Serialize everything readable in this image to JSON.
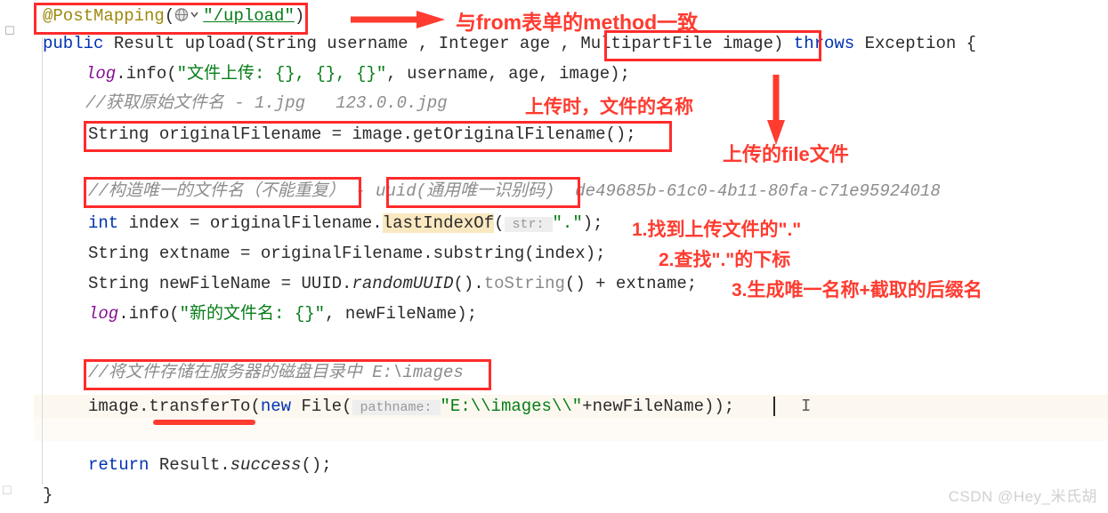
{
  "editor": {
    "gutter_icon": "globe-annotation-gutter-icon",
    "current_line_highlight_color": "#fdf8ef",
    "caret_glyph": "|",
    "mouse_cursor_glyph": "I"
  },
  "code_lines": [
    {
      "id": "line-postmapping",
      "segments": [
        {
          "text": "@PostMapping",
          "style": "anno"
        },
        {
          "text": "(",
          "style": "plain"
        },
        {
          "text": "globe-icon",
          "style": "icon"
        },
        {
          "text": "\"/upload\"",
          "style": "str-underline"
        },
        {
          "text": ")",
          "style": "plain"
        }
      ],
      "plain": "@PostMapping(\"/upload\")"
    },
    {
      "id": "line-method-signature",
      "segments": [
        {
          "text": "public ",
          "style": "keyword"
        },
        {
          "text": "Result ",
          "style": "plain"
        },
        {
          "text": "upload",
          "style": "plain"
        },
        {
          "text": "(String username , Integer age , MultipartFile image) ",
          "style": "plain"
        },
        {
          "text": "throws ",
          "style": "keyword"
        },
        {
          "text": "Exception {",
          "style": "plain"
        }
      ],
      "plain": "public Result upload(String username , Integer age , MultipartFile image) throws Exception {"
    },
    {
      "id": "line-log-info-1",
      "plain": "log.info(\"文件上传: {}, {}, {}\", username, age, image);"
    },
    {
      "id": "line-comment-originalname",
      "plain": "//获取原始文件名 - 1.jpg   123.0.0.jpg"
    },
    {
      "id": "line-original-filename",
      "plain": "String originalFilename = image.getOriginalFilename();"
    },
    {
      "id": "line-comment-uuid",
      "plain": "//构造唯一的文件名（不能重复） - uuid(通用唯一识别码)   de49685b-61c0-4b11-80fa-c71e95924018"
    },
    {
      "id": "line-index",
      "plain": "int index = originalFilename.lastIndexOf( str: \".\");"
    },
    {
      "id": "line-extname",
      "plain": "String extname = originalFilename.substring(index);"
    },
    {
      "id": "line-newfilename",
      "plain": "String newFileName = UUID.randomUUID().toString() + extname;"
    },
    {
      "id": "line-log-info-2",
      "plain": "log.info(\"新的文件名: {}\", newFileName);"
    },
    {
      "id": "line-comment-store",
      "plain": "//将文件存储在服务器的磁盘目录中 E:\\images"
    },
    {
      "id": "line-transferto",
      "plain": "image.transferTo(new File( pathname: \"E:\\\\images\\\\\"+newFileName));"
    },
    {
      "id": "line-return",
      "plain": "return Result.success();"
    },
    {
      "id": "line-close-brace",
      "plain": "}"
    }
  ],
  "code_tokens": {
    "annotation_name": "@PostMapping",
    "annotation_open_paren": "(",
    "annotation_path": "\"/upload\"",
    "annotation_close_paren": ")",
    "sig_public": "public ",
    "sig_result": "Result ",
    "sig_upload": "upload",
    "sig_params_1": "(String username , Integer age , ",
    "sig_param_multipart": "MultipartFile image",
    "sig_params_2": ") ",
    "sig_throws": "throws ",
    "sig_exception": "Exception {",
    "log_name": "log",
    "log_info_1_call": ".info(",
    "log_info_1_str": "\"文件上传: {}, {}, {}\"",
    "log_info_1_args": ", username, age, image);",
    "comment_original": "//获取原始文件名",
    "comment_original_tail": " - 1.jpg   123.0.0.jpg",
    "original_filename_stmt": "String originalFilename = image.getOriginalFilename();",
    "comment_uuid_part1": "//构造唯一的文件名（不能重复）",
    "comment_uuid_dash": " - ",
    "comment_uuid_part2": "uuid(通用唯一识别码)",
    "comment_uuid_value": "de49685b-61c0-4b11-80fa-c71e95924018",
    "index_kw": "int",
    "index_mid": " index = originalFilename.",
    "index_method": "lastIndexOf",
    "index_paren": "(",
    "index_hint": " str: ",
    "index_dotstr": "\".\"",
    "index_tail": ");",
    "extname_stmt": "String extname = originalFilename.substring(index);",
    "newfile_head": "String newFileName = UUID.",
    "newfile_random": "randomUUID",
    "newfile_mid": "().",
    "newfile_tostring": "toString",
    "newfile_tail": "() + extname;",
    "log_info_2_call": ".info(",
    "log_info_2_str": "\"新的文件名: {}\"",
    "log_info_2_args": ", newFileName);",
    "comment_store_cn": "//将文件存储在服务器的磁盘目录中",
    "comment_store_path": " E:\\images",
    "transfer_head": "image.",
    "transfer_method": "transferTo",
    "transfer_paren": "(",
    "transfer_new": "new",
    "transfer_file": " File(",
    "transfer_hint": " pathname: ",
    "transfer_str": "\"E:\\\\images\\\\\"",
    "transfer_tail": "+newFileName));",
    "return_kw": "return",
    "return_result": " Result.",
    "return_success": "success",
    "return_tail": "();",
    "close_brace": "}"
  },
  "annotations": [
    {
      "id": "ann-method-consistent",
      "text": "与from表单的method一致",
      "color": "#ff3b30",
      "arrow": "right-arrow-icon"
    },
    {
      "id": "ann-filename-on-upload",
      "text": "上传时，文件的名称",
      "color": "#ff3b30"
    },
    {
      "id": "ann-uploaded-file",
      "text": "上传的file文件",
      "color": "#ff3b30",
      "arrow": "down-arrow-icon"
    },
    {
      "id": "ann-step-1",
      "text": "1.找到上传文件的\".\"",
      "color": "#ff3b30"
    },
    {
      "id": "ann-step-2",
      "text": "2.查找\".\"的下标",
      "color": "#ff3b30"
    },
    {
      "id": "ann-step-3",
      "text": "3.生成唯一名称+截取的后缀名",
      "color": "#ff3b30"
    }
  ],
  "highlight_boxes": [
    {
      "id": "box-postmapping",
      "target": "@PostMapping(\"/upload\")"
    },
    {
      "id": "box-multipartfile",
      "target": "MultipartFile image"
    },
    {
      "id": "box-original-filename",
      "target": "String originalFilename = image.getOriginalFilename();"
    },
    {
      "id": "box-comment-uuid",
      "target": "//构造唯一的文件名（不能重复）"
    },
    {
      "id": "box-uuid-label",
      "target": "uuid(通用唯一识别码)"
    },
    {
      "id": "box-comment-store",
      "target": "//将文件存储在服务器的磁盘目录中 E:\\images"
    }
  ],
  "colors": {
    "annotation_red": "#ff3b30",
    "box_red": "#ff2b2b",
    "keyword_blue": "#0033b3",
    "string_green": "#067d17",
    "comment_gray": "#8c8c8c",
    "annotation_gold": "#9e880d",
    "field_purple": "#871094",
    "method_highlight": "#fae8c0",
    "current_line": "#fdf8ef"
  },
  "watermark": {
    "text": "CSDN @Hey_米氏胡"
  }
}
